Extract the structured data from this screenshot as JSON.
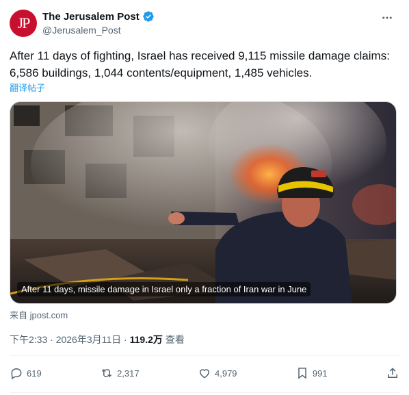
{
  "author": {
    "avatar_text": "JP",
    "display_name": "The Jerusalem Post",
    "handle": "@Jerusalem_Post",
    "verified_icon": "verified-badge-icon",
    "accent_color": "#1d9bf0",
    "brand_color": "#c8102e"
  },
  "tweet": {
    "text": "After 11 days of fighting, Israel has received 9,115 missile damage claims: 6,586 buildings, 1,044 contents/equipment, 1,485 vehicles.",
    "translate_label": "翻译帖子"
  },
  "media": {
    "caption": "After 11 days, missile damage in Israel only a fraction of Iran war in June"
  },
  "source": "来自 jpost.com",
  "meta": {
    "time": "下午2:33",
    "separator": " · ",
    "date": "2026年3月11日",
    "separator2": " · ",
    "views": "119.2万",
    "views_label": "查看"
  },
  "actions": {
    "replies": "619",
    "reposts": "2,317",
    "likes": "4,979",
    "bookmarks": "991"
  }
}
